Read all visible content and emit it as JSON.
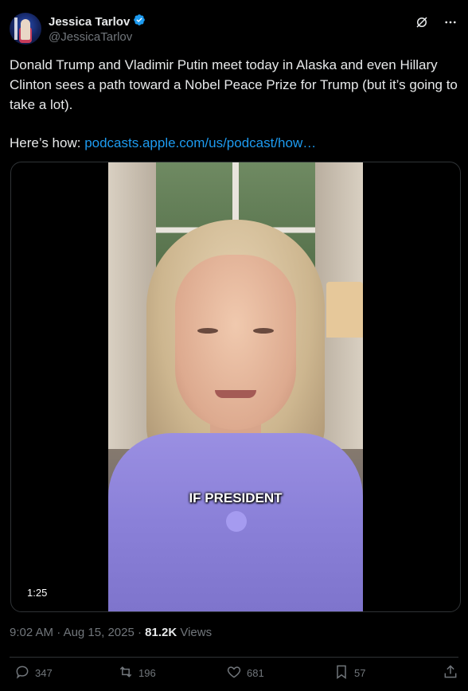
{
  "author": {
    "name": "Jessica Tarlov",
    "handle": "@JessicaTarlov",
    "avatar_icon": "profile-photo",
    "verified_color": "#1d9bf0"
  },
  "header_icons": [
    "grok-icon",
    "more-icon"
  ],
  "tweet": {
    "text": "Donald Trump and Vladimir Putin meet today in Alaska and even Hillary Clinton sees a path toward a Nobel Peace Prize for Trump (but it’s going to take a lot).",
    "link_prefix": "Here’s how:",
    "link_text": "podcasts.apple.com/us/podcast/how…"
  },
  "media": {
    "caption": "IF PRESIDENT",
    "duration": "1:25"
  },
  "meta": {
    "time": "9:02 AM",
    "date": "Aug 15, 2025",
    "views_count": "81.2K",
    "views_label": "Views"
  },
  "actions": {
    "replies": "347",
    "reposts": "196",
    "likes": "681",
    "bookmarks": "57"
  },
  "colors": {
    "background": "#000000",
    "text": "#e7e9ea",
    "muted": "#71767b",
    "link": "#1d9bf0",
    "border": "#2f3336"
  }
}
